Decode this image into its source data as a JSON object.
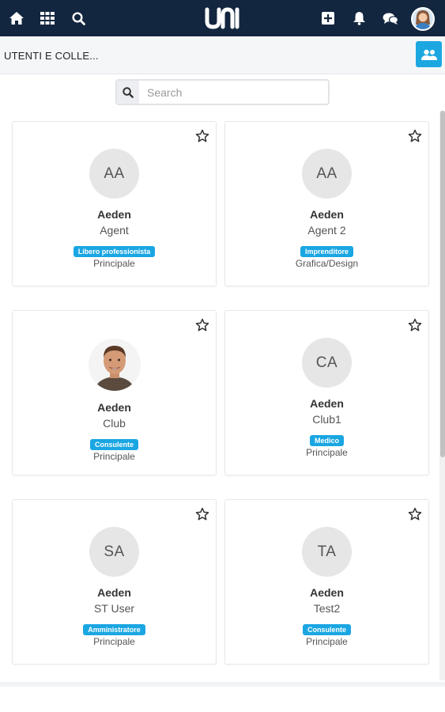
{
  "topbar": {
    "logo_text": "UNI"
  },
  "subbar": {
    "title": "UTENTI E COLLE..."
  },
  "search": {
    "placeholder": "Search",
    "value": ""
  },
  "colors": {
    "navbar": "#13263f",
    "accent": "#1da7e0",
    "badge": "#1aa6e2",
    "avatar_bg": "#e6e6e6"
  },
  "cards": [
    {
      "initials": "AA",
      "name": "Aeden",
      "subtitle": "Agent",
      "badge": "Libero professionista",
      "department": "Principale"
    },
    {
      "initials": "AA",
      "name": "Aeden",
      "subtitle": "Agent 2",
      "badge": "Imprenditore",
      "department": "Grafica/Design"
    },
    {
      "initials": "",
      "name": "Aeden",
      "subtitle": "Club",
      "badge": "Consulente",
      "department": "Principale"
    },
    {
      "initials": "CA",
      "name": "Aeden",
      "subtitle": "Club1",
      "badge": "Medico",
      "department": "Principale"
    },
    {
      "initials": "SA",
      "name": "Aeden",
      "subtitle": "ST User",
      "badge": "Amministratore",
      "department": "Principale"
    },
    {
      "initials": "TA",
      "name": "Aeden",
      "subtitle": "Test2",
      "badge": "Consulente",
      "department": "Principale"
    }
  ]
}
